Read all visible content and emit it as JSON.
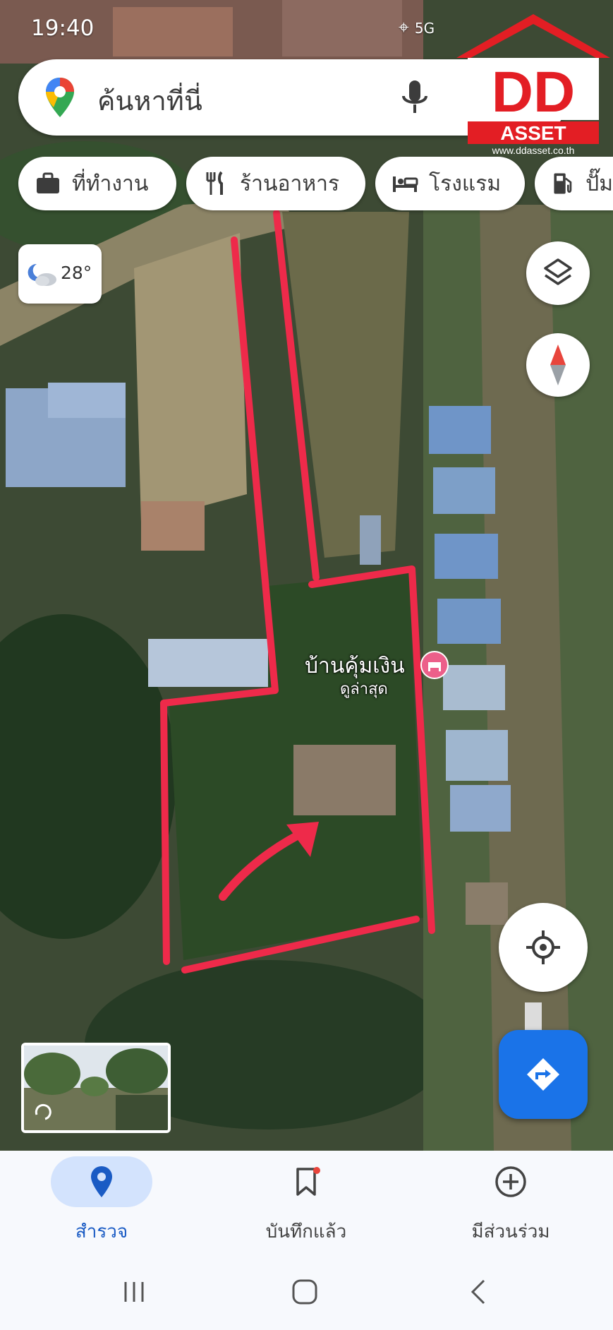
{
  "status": {
    "time": "19:40",
    "network": "5G"
  },
  "search": {
    "placeholder": "ค้นหาที่นี่"
  },
  "chips": [
    {
      "label": "ที่ทำงาน",
      "icon": "briefcase-icon"
    },
    {
      "label": "ร้านอาหาร",
      "icon": "restaurant-icon"
    },
    {
      "label": "โรงแรม",
      "icon": "hotel-icon"
    },
    {
      "label": "ปั๊ม",
      "icon": "gas-station-icon"
    }
  ],
  "weather": {
    "temperature": "28°",
    "icon": "partly-cloudy-icon"
  },
  "place": {
    "name": "บ้านคุ้มเงิน",
    "subtitle": "ดูล่าสุด",
    "icon": "hotel-pin-icon"
  },
  "logo": {
    "brand": "DD",
    "tagline": "ASSET",
    "url": "www.ddasset.co.th"
  },
  "bottom_nav": [
    {
      "label": "สำรวจ",
      "icon": "location-pin-icon",
      "active": true
    },
    {
      "label": "บันทึกแล้ว",
      "icon": "bookmark-icon",
      "active": false,
      "badge": true
    },
    {
      "label": "มีส่วนร่วม",
      "icon": "add-circle-icon",
      "active": false
    }
  ],
  "colors": {
    "accent": "#1a73e8",
    "boundary": "#ee2a4a",
    "logo_red": "#e31e24"
  }
}
